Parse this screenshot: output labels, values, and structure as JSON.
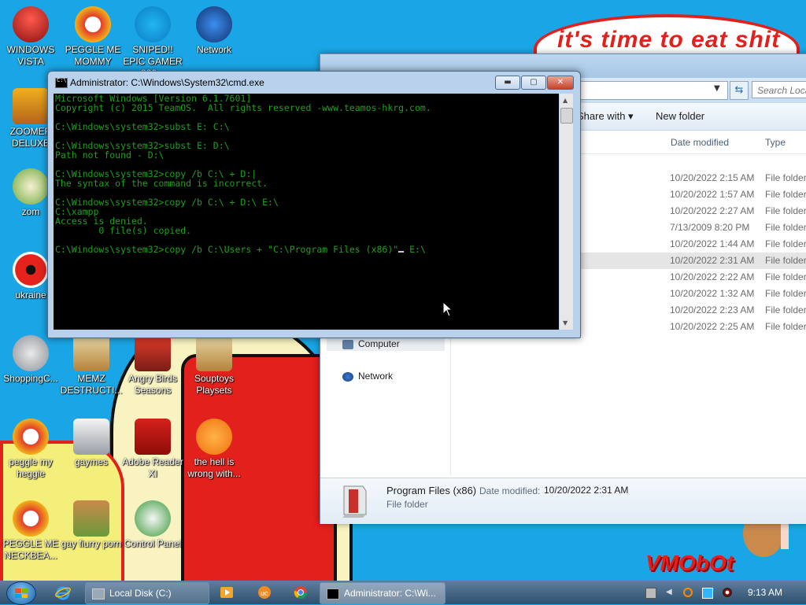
{
  "wallpaper": {
    "caption": "it's time to eat shit",
    "signature": "VMObOt"
  },
  "desktop_icons": [
    {
      "label": "WINDOWS VISTA",
      "icon": "vista-icon"
    },
    {
      "label": "PEGGLE ME MOMMY",
      "icon": "peggle-icon"
    },
    {
      "label": "SNIPED!! EPIC GAMER 360...",
      "icon": "skype-icon"
    },
    {
      "label": "Network",
      "icon": "network-icon"
    },
    {
      "label": "ZOOMER DELUXE",
      "icon": "zuma-icon"
    },
    {
      "label": "zom",
      "icon": "zombie-icon"
    },
    {
      "label": "ukraine",
      "icon": "radiation-icon"
    },
    {
      "label": "ShoppingC...",
      "icon": "flash-icon"
    },
    {
      "label": "MEMZ DESTRUCTI...",
      "icon": "memz-icon"
    },
    {
      "label": "Angry Birds Seasons",
      "icon": "angry-birds-icon"
    },
    {
      "label": "Souptoys Playsets",
      "icon": "souptoys-icon"
    },
    {
      "label": "peggle my heggie",
      "icon": "peggle-icon"
    },
    {
      "label": "gaymes",
      "icon": "games-folder-icon"
    },
    {
      "label": "Adobe Reader XI",
      "icon": "adobe-reader-icon"
    },
    {
      "label": "the hell is wrong with...",
      "icon": "uc-browser-icon"
    },
    {
      "label": "PEGGLE ME NECKBEA...",
      "icon": "peggle-icon"
    },
    {
      "label": "gay fiurry porn",
      "icon": "gopher-box-icon"
    },
    {
      "label": "Control Panel",
      "icon": "control-panel-icon"
    }
  ],
  "explorer": {
    "search_placeholder": "Search Loca",
    "toolbar": {
      "share_with": "Share with ▾",
      "new_folder": "New folder"
    },
    "columns": {
      "date_modified": "Date modified",
      "type": "Type"
    },
    "rows": [
      {
        "date": "10/20/2022 2:15 AM",
        "type": "File folder"
      },
      {
        "date": "10/20/2022 1:57 AM",
        "type": "File folder"
      },
      {
        "date": "10/20/2022 2:27 AM",
        "type": "File folder"
      },
      {
        "date": "7/13/2009 8:20 PM",
        "type": "File folder"
      },
      {
        "date": "10/20/2022 1:44 AM",
        "type": "File folder"
      },
      {
        "date": "10/20/2022 2:31 AM",
        "type": "File folder"
      },
      {
        "date": "10/20/2022 2:22 AM",
        "type": "File folder"
      },
      {
        "date": "10/20/2022 1:32 AM",
        "type": "File folder"
      },
      {
        "date": "10/20/2022 2:23 AM",
        "type": "File folder"
      },
      {
        "date": "10/20/2022 2:25 AM",
        "type": "File folder"
      }
    ],
    "nav": {
      "computer": "Computer",
      "network": "Network"
    },
    "details": {
      "name": "Program Files (x86)",
      "date_label": "Date modified:",
      "date_value": "10/20/2022 2:31 AM",
      "type": "File folder"
    }
  },
  "cmd": {
    "title": "Administrator: C:\\Windows\\System32\\cmd.exe",
    "lines": [
      "Microsoft Windows [Version 6.1.7601]",
      "Copyright (c) 2015 TeamOS.  All rights reserved -www.teamos-hkrg.com.",
      "",
      "C:\\Windows\\system32>subst E: C:\\",
      "",
      "C:\\Windows\\system32>subst E: D:\\",
      "Path not found - D:\\",
      "",
      "C:\\Windows\\system32>copy /b C:\\ + D:|",
      "The syntax of the command is incorrect.",
      "",
      "C:\\Windows\\system32>copy /b C:\\ + D:\\ E:\\",
      "C:\\xampp",
      "Access is denied.",
      "        0 file(s) copied.",
      ""
    ],
    "input_before": "C:\\Windows\\system32>copy /b C:\\Users + \"C:\\Program Files (x86)\"",
    "input_after": " E:\\"
  },
  "taskbar": {
    "local_disk": "Local Disk (C:)",
    "cmd_task": "Administrator: C:\\Wi...",
    "clock": "9:13 AM"
  }
}
